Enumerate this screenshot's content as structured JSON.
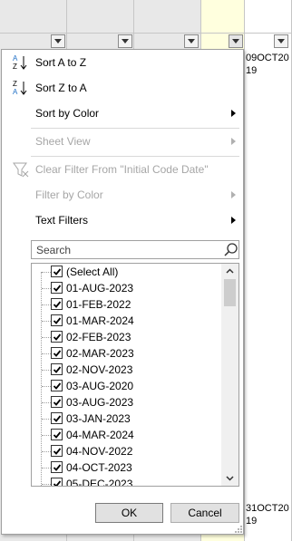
{
  "sheet": {
    "cell_top": "09OCT20\n19",
    "cell_bottom": "31OCT20\n19"
  },
  "filter_menu": {
    "sort_asc": "Sort A to Z",
    "sort_desc": "Sort Z to A",
    "sort_by_color": "Sort by Color",
    "sheet_view": "Sheet View",
    "clear_filter": "Clear Filter From \"Initial Code Date\"",
    "filter_by_color": "Filter by Color",
    "text_filters": "Text Filters",
    "search_placeholder": "Search",
    "items": [
      {
        "label": "(Select All)",
        "checked": true
      },
      {
        "label": "01-AUG-2023",
        "checked": true
      },
      {
        "label": "01-FEB-2022",
        "checked": true
      },
      {
        "label": "01-MAR-2024",
        "checked": true
      },
      {
        "label": "02-FEB-2023",
        "checked": true
      },
      {
        "label": "02-MAR-2023",
        "checked": true
      },
      {
        "label": "02-NOV-2023",
        "checked": true
      },
      {
        "label": "03-AUG-2020",
        "checked": true
      },
      {
        "label": "03-AUG-2023",
        "checked": true
      },
      {
        "label": "03-JAN-2023",
        "checked": true
      },
      {
        "label": "04-MAR-2024",
        "checked": true
      },
      {
        "label": "04-NOV-2022",
        "checked": true
      },
      {
        "label": "04-OCT-2023",
        "checked": true
      },
      {
        "label": "05-DEC-2023",
        "checked": true
      }
    ],
    "ok_label": "OK",
    "cancel_label": "Cancel"
  },
  "colors": {
    "highlight_column": "#ffffde",
    "sort_icon_blue": "#1f6fc5"
  }
}
